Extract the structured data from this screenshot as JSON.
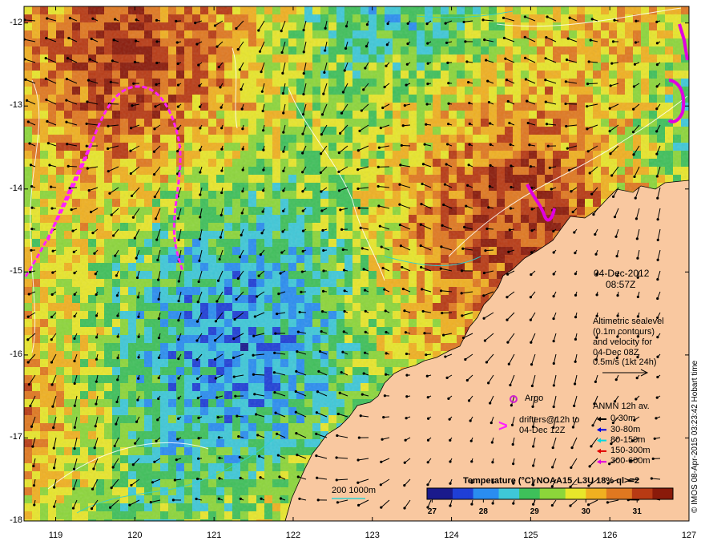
{
  "map": {
    "lon_range": [
      118.6,
      127.0
    ],
    "lat_range": [
      -18.0,
      -11.8
    ],
    "x_ticks": [
      "119",
      "120",
      "121",
      "122",
      "123",
      "124",
      "125",
      "126",
      "127"
    ],
    "y_ticks": [
      "-12",
      "-13",
      "-14",
      "-15",
      "-16",
      "-17",
      "-18"
    ],
    "land_color": "#f9c8a0",
    "palette": [
      "#1a1a8c",
      "#1f3fd6",
      "#2a8df0",
      "#3ec8d8",
      "#3ec05a",
      "#8cd63a",
      "#e8e62a",
      "#f0b020",
      "#e07820",
      "#b83a14",
      "#8a1a0a"
    ]
  },
  "date": {
    "day": "04-Dec-2012",
    "time": "08:57Z"
  },
  "altimetry_note": {
    "lines": [
      "Altimetric sealevel",
      "(0.1m contours)",
      "and velocity for",
      "04-Dec 08Z",
      "0.5m/s (1kt 24h)"
    ]
  },
  "argo": {
    "label": "Argo",
    "color": "#d020d0"
  },
  "drifters": {
    "line1": "drifters@12h to",
    "line2": "04-Dec 12Z",
    "color": "#ff20ff"
  },
  "anmn": {
    "title": "ANMN 12h av.",
    "items": [
      {
        "label": "0-30m",
        "color": "#000000"
      },
      {
        "label": "30-80m",
        "color": "#0000e0"
      },
      {
        "label": "80-150m",
        "color": "#00d8e0"
      },
      {
        "label": "150-300m",
        "color": "#e00000"
      },
      {
        "label": "300-600m",
        "color": "#e000e0"
      }
    ]
  },
  "bathymetry": {
    "label": "200 1000m",
    "color": "#30d0d0"
  },
  "colorbar": {
    "title": "Temperature (°C) NOAA15_L3U 18% ql>=2",
    "ticks": [
      "27",
      "28",
      "29",
      "30",
      "31"
    ],
    "range": [
      26.9,
      31.7
    ]
  },
  "credit": "© IMOS 08-Apr-2015 03:23:42 Hobart time"
}
